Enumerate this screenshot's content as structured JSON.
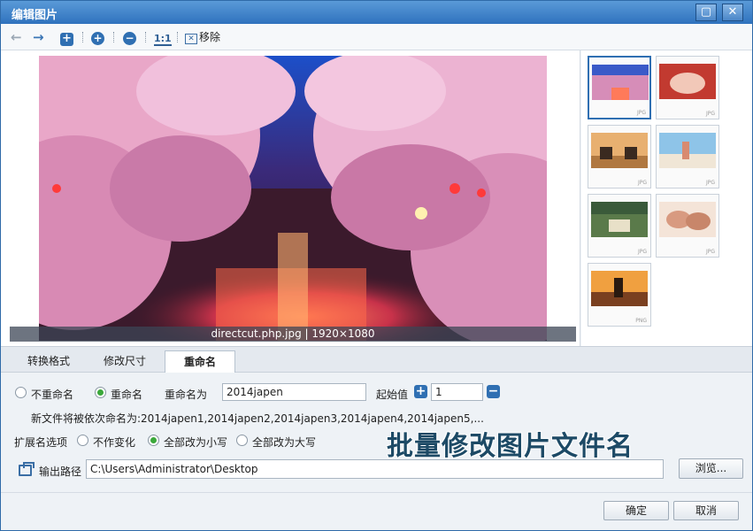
{
  "window": {
    "title": "编辑图片",
    "maximize_glyph": "▢",
    "close_glyph": "✕"
  },
  "toolbar": {
    "back_icon": "←",
    "forward_icon": "→",
    "add_icon": "+",
    "zoom_in_icon": "+",
    "zoom_out_icon": "−",
    "actual_size_label": "1:1",
    "remove_label": "移除"
  },
  "preview": {
    "caption": "directcut.php.jpg | 1920×1080"
  },
  "thumbnails": [
    {
      "tag": "JPG",
      "selected": true
    },
    {
      "tag": "JPG",
      "selected": false
    },
    {
      "tag": "JPG",
      "selected": false
    },
    {
      "tag": "JPG",
      "selected": false
    },
    {
      "tag": "JPG",
      "selected": false
    },
    {
      "tag": "JPG",
      "selected": false
    },
    {
      "tag": "PNG",
      "selected": false
    }
  ],
  "tabs": [
    {
      "label": "转换格式",
      "active": false
    },
    {
      "label": "修改尺寸",
      "active": false
    },
    {
      "label": "重命名",
      "active": true
    }
  ],
  "rename": {
    "no_rename_label": "不重命名",
    "rename_label": "重命名",
    "rename_selected": true,
    "rename_as_label": "重命名为",
    "rename_as_value": "2014japen",
    "start_value_label": "起始值",
    "start_value": "1",
    "preview_text": "新文件将被依次命名为:2014japen1,2014japen2,2014japen3,2014japen4,2014japen5,..."
  },
  "extension": {
    "label": "扩展名选项",
    "options": [
      {
        "label": "不作变化",
        "selected": false
      },
      {
        "label": "全部改为小写",
        "selected": true
      },
      {
        "label": "全部改为大写",
        "selected": false
      }
    ]
  },
  "output": {
    "label": "输出路径",
    "path": "C:\\Users\\Administrator\\Desktop",
    "browse_label": "浏览..."
  },
  "watermark_text": "批量修改图片文件名",
  "footer": {
    "ok_label": "确定",
    "cancel_label": "取消"
  }
}
